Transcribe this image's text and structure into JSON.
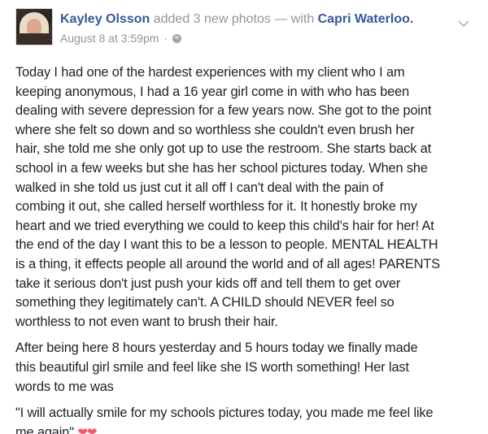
{
  "post": {
    "author": "Kayley Olsson",
    "action": "added 3 new photos",
    "with_prefix": "— with",
    "tagged": "Capri Waterloo.",
    "timestamp": "August 8 at 3:59pm",
    "dot": "·",
    "privacy_icon": "globe-icon",
    "menu_icon": "chevron-down-icon",
    "paragraphs": [
      "Today I had one of the hardest experiences with my client who I am\nkeeping anonymous, I had a 16 year girl come in with who has been\ndealing with severe depression for a few years now. She got to the point\nwhere she felt so down and so worthless she couldn't even brush her\nhair, she told me she only got up to use the restroom. She starts back at\nschool in a few weeks but she has her school pictures today. When she\nwalked in she told us just cut it all off I can't deal with the pain of\ncombing it out, she called herself worthless for it. It honestly broke my\nheart and we tried everything we could to keep this child's hair for her! At\nthe end of the day I want this to be a lesson to people. MENTAL HEALTH\nis a thing, it effects people all around the world and of all ages! PARENTS\ntake it serious don't just push your kids off and tell them to get over\nsomething they legitimately can't. A CHILD should NEVER feel so\nworthless to not even want to brush their hair.",
      "After being here 8 hours yesterday and 5 hours today we finally made\nthis beautiful girl smile and feel like she IS worth something! Her last\nwords to me was"
    ],
    "quote": "\"I will actually smile for my schools pictures today, you made me feel like\nme again\"",
    "quote_emoji": "❤❤"
  },
  "colors": {
    "link": "#365899",
    "secondary_text": "#90949c",
    "body_text": "#1d2129",
    "heart": "#f3596e"
  }
}
